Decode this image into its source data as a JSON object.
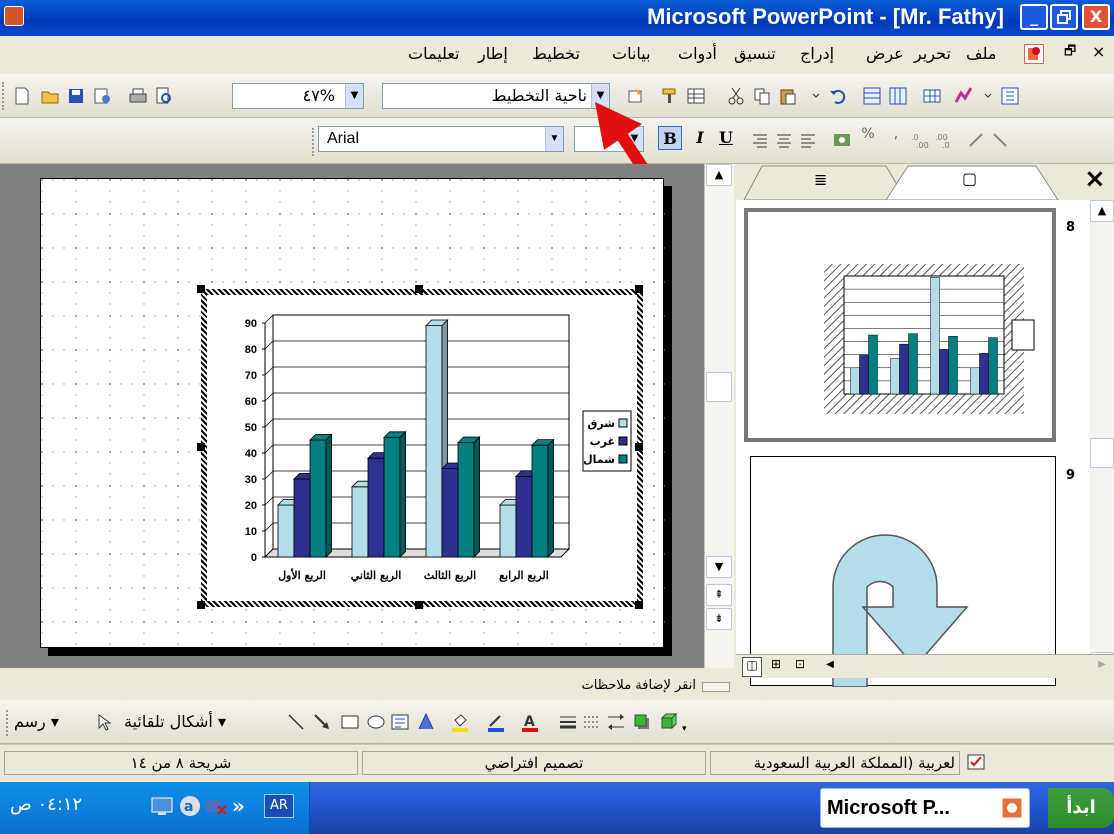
{
  "window": {
    "title": "Microsoft PowerPoint - [Mr. Fathy]",
    "min_label": "_",
    "restore_label": "🗗",
    "close_label": "X"
  },
  "menubar": {
    "items": [
      "تعليمات",
      "إطار",
      "تخطيط",
      "بيانات",
      "أدوات",
      "تنسيق",
      "إدراج",
      "عرض",
      "تحرير",
      "ملف"
    ],
    "close_doc": "×",
    "restore_doc": "🗗"
  },
  "toolbar1": {
    "zoom_value": "٤٧%",
    "chart_object_value": "ناحية التخطيط"
  },
  "toolbar2": {
    "font_value": "Arial",
    "bold": "B",
    "italic": "I",
    "underline": "U",
    "percent": "%"
  },
  "chart_data": {
    "type": "bar",
    "categories": [
      "الربع الأول",
      "الربع الثاني",
      "الربع الثالث",
      "الربع الرابع"
    ],
    "series": [
      {
        "name": "شرق",
        "values": [
          20,
          27,
          89,
          20
        ],
        "color": "#b3dde8"
      },
      {
        "name": "غرب",
        "values": [
          30,
          38,
          34,
          31
        ],
        "color": "#2e3192"
      },
      {
        "name": "شمال",
        "values": [
          45,
          46,
          44,
          43
        ],
        "color": "#008080"
      }
    ],
    "yticks": [
      "0",
      "10",
      "20",
      "30",
      "40",
      "50",
      "60",
      "70",
      "80",
      "90"
    ],
    "ylim": [
      0,
      90
    ],
    "grid": true,
    "legend_placement": "right"
  },
  "panel": {
    "tab_outline": "≣",
    "tab_slides": "▢",
    "close": "×",
    "slide8_number": "8",
    "slide9_number": "9"
  },
  "notes": {
    "placeholder": "انقر لإضافة ملاحظات"
  },
  "drawbar": {
    "draw_label": "رسم",
    "autoshapes_label": "أشكال تلقائية"
  },
  "status": {
    "slide_position": "شريحة ٨ من ١٤",
    "design": "تصميم افتراضي",
    "language": "لعربية (المملكة العربية السعودية"
  },
  "taskbar": {
    "start_label": "ابدأ",
    "task_label": "Microsoft P...",
    "clock": "٠٤:١٢ ص",
    "lang": "AR",
    "chevron": "»"
  },
  "colors": {
    "title_bar": "#0a5fd8",
    "arrow_annotation": "#e01010",
    "taskbar": "#245ddb"
  }
}
